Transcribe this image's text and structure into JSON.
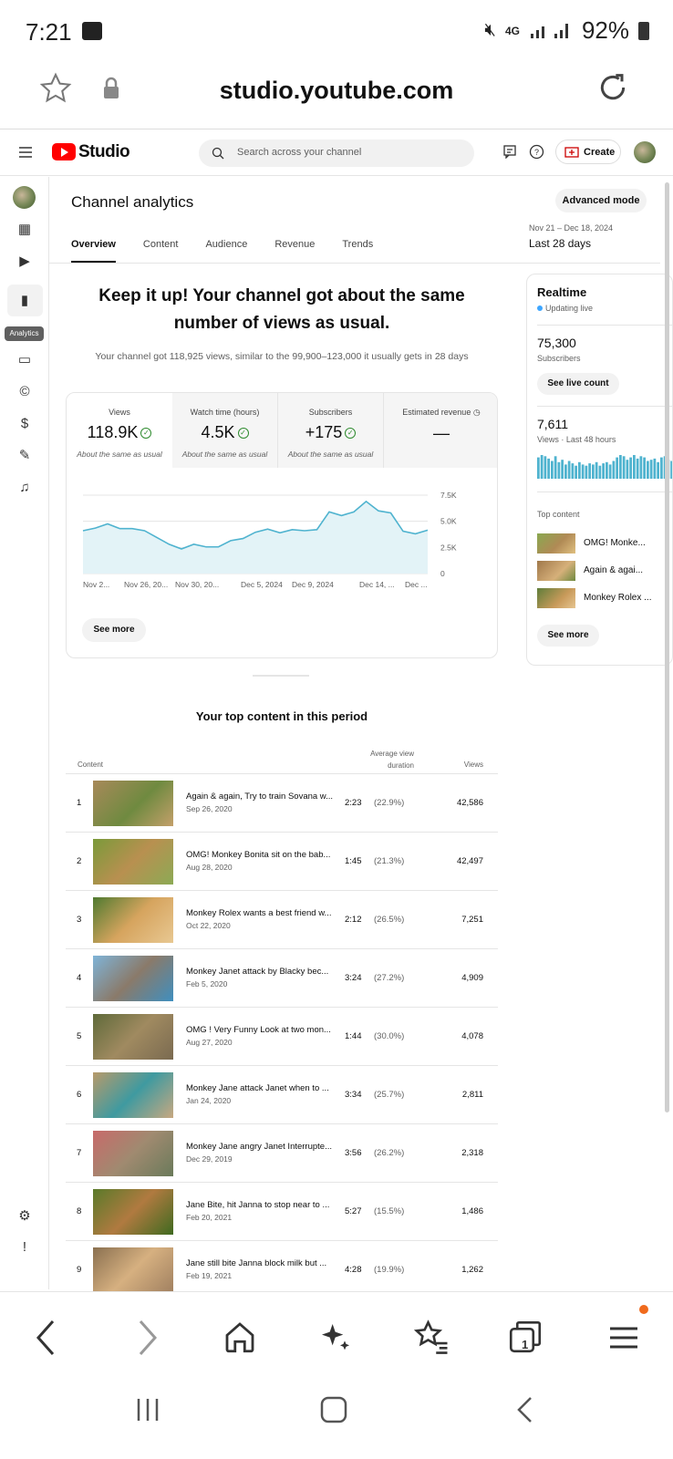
{
  "status_bar": {
    "time": "7:21",
    "network": "4G",
    "battery": "92%"
  },
  "browser": {
    "url": "studio.youtube.com",
    "tab_count": "1"
  },
  "studio": {
    "logo": "Studio",
    "search_placeholder": "Search across your channel",
    "create_label": "Create"
  },
  "rail": {
    "tooltip": "Analytics"
  },
  "main": {
    "title": "Channel analytics",
    "advanced_mode": "Advanced mode",
    "tabs": [
      "Overview",
      "Content",
      "Audience",
      "Revenue",
      "Trends"
    ],
    "date_range": "Nov 21 – Dec 18, 2024",
    "period": "Last 28 days",
    "headline": "Keep it up! Your channel got about the same number of views as usual.",
    "subline": "Your channel got 118,925 views, similar to the 99,900–123,000 it usually gets in 28 days",
    "metrics": [
      {
        "label": "Views",
        "value": "118.9K",
        "note": "About the same as usual"
      },
      {
        "label": "Watch time (hours)",
        "value": "4.5K",
        "note": "About the same as usual"
      },
      {
        "label": "Subscribers",
        "value": "+175",
        "note": "About the same as usual"
      },
      {
        "label": "Estimated revenue",
        "value": "—",
        "note": ""
      }
    ],
    "see_more": "See more"
  },
  "chart_data": {
    "type": "area",
    "x_ticks": [
      "Nov 2...",
      "Nov 26, 20...",
      "Nov 30, 20...",
      "Dec 5, 2024",
      "Dec 9, 2024",
      "Dec 14, ...",
      "Dec ..."
    ],
    "y_ticks": [
      "0",
      "2.5K",
      "5.0K",
      "7.5K"
    ],
    "ylim": [
      0,
      7500
    ],
    "values": [
      4100,
      4350,
      4750,
      4300,
      4300,
      4100,
      3450,
      2800,
      2350,
      2800,
      2550,
      2550,
      3150,
      3350,
      3950,
      4250,
      3900,
      4200,
      4100,
      4200,
      5900,
      5550,
      5900,
      6900,
      6000,
      5800,
      4050,
      3800,
      4150
    ],
    "grid": true
  },
  "realtime": {
    "title": "Realtime",
    "status": "Updating live",
    "subscribers": "75,300",
    "subscribers_label": "Subscribers",
    "live_count_btn": "See live count",
    "views": "7,611",
    "views_label": "Views · Last 48 hours",
    "bars": [
      0.9,
      1,
      0.95,
      0.85,
      0.75,
      0.95,
      0.7,
      0.8,
      0.6,
      0.75,
      0.65,
      0.55,
      0.7,
      0.6,
      0.55,
      0.65,
      0.6,
      0.7,
      0.55,
      0.65,
      0.7,
      0.6,
      0.75,
      0.9,
      1,
      0.95,
      0.8,
      0.9,
      1,
      0.85,
      0.95,
      0.9,
      0.75,
      0.8,
      0.85,
      0.7,
      0.9,
      0.95,
      0.8,
      0.75
    ],
    "top_content_label": "Top content",
    "top_content": [
      "OMG! Monke...",
      "Again & agai...",
      "Monkey Rolex ..."
    ],
    "see_more": "See more"
  },
  "top_content": {
    "title": "Your top content in this period",
    "headers": {
      "content": "Content",
      "avg_duration": "Average view duration",
      "views": "Views"
    },
    "rows": [
      {
        "rank": "1",
        "title": "Again & again, Try to train Sovana w...",
        "date": "Sep 26, 2020",
        "duration": "2:23",
        "pct": "(22.9%)",
        "views": "42,586"
      },
      {
        "rank": "2",
        "title": "OMG! Monkey Bonita sit on the bab...",
        "date": "Aug 28, 2020",
        "duration": "1:45",
        "pct": "(21.3%)",
        "views": "42,497"
      },
      {
        "rank": "3",
        "title": "Monkey Rolex wants a best friend w...",
        "date": "Oct 22, 2020",
        "duration": "2:12",
        "pct": "(26.5%)",
        "views": "7,251"
      },
      {
        "rank": "4",
        "title": "Monkey Janet attack by Blacky bec...",
        "date": "Feb 5, 2020",
        "duration": "3:24",
        "pct": "(27.2%)",
        "views": "4,909"
      },
      {
        "rank": "5",
        "title": "OMG ! Very Funny Look at two mon...",
        "date": "Aug 27, 2020",
        "duration": "1:44",
        "pct": "(30.0%)",
        "views": "4,078"
      },
      {
        "rank": "6",
        "title": "Monkey Jane attack Janet when to ...",
        "date": "Jan 24, 2020",
        "duration": "3:34",
        "pct": "(25.7%)",
        "views": "2,811"
      },
      {
        "rank": "7",
        "title": "Monkey Jane angry Janet Interrupte...",
        "date": "Dec 29, 2019",
        "duration": "3:56",
        "pct": "(26.2%)",
        "views": "2,318"
      },
      {
        "rank": "8",
        "title": "Jane Bite, hit Janna to stop near to ...",
        "date": "Feb 20, 2021",
        "duration": "5:27",
        "pct": "(15.5%)",
        "views": "1,486"
      },
      {
        "rank": "9",
        "title": "Jane still bite Janna block milk but ...",
        "date": "Feb 19, 2021",
        "duration": "4:28",
        "pct": "(19.9%)",
        "views": "1,262"
      }
    ]
  }
}
